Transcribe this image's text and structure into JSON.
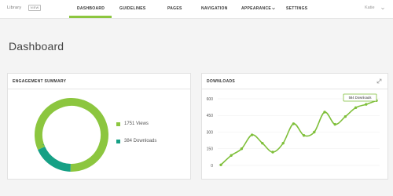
{
  "topbar": {
    "brand": "Library",
    "view_badge": "VIEW",
    "nav": [
      {
        "label": "DASHBOARD"
      },
      {
        "label": "GUIDELINES"
      },
      {
        "label": "PAGES"
      },
      {
        "label": "NAVIGATION"
      },
      {
        "label": "APPEARANCE"
      },
      {
        "label": "SETTINGS"
      }
    ],
    "user": "Katie"
  },
  "page": {
    "title": "Dashboard"
  },
  "engagement": {
    "title": "ENGAGEMENT SUMMARY",
    "legend": [
      {
        "label": "1751 Views",
        "color": "#8cc63f"
      },
      {
        "label": "384 Downloads",
        "color": "#16a085"
      }
    ]
  },
  "downloads": {
    "title": "DOWNLOADS",
    "tooltip": "584 Downloads"
  },
  "colors": {
    "accent": "#8cc63f",
    "teal": "#16a085",
    "line": "#7fbf3a"
  },
  "chart_data": [
    {
      "type": "pie",
      "title": "ENGAGEMENT SUMMARY",
      "slices": [
        {
          "label": "Views",
          "value": 1751
        },
        {
          "label": "Downloads",
          "value": 384
        }
      ]
    },
    {
      "type": "line",
      "title": "DOWNLOADS",
      "ylim": [
        0,
        600
      ],
      "yticks": [
        0,
        150,
        300,
        450,
        600
      ],
      "grid": true,
      "series": [
        {
          "values": [
            5,
            90,
            150,
            275,
            200,
            120,
            200,
            375,
            270,
            300,
            480,
            370,
            440,
            520,
            550,
            584
          ]
        }
      ]
    }
  ]
}
